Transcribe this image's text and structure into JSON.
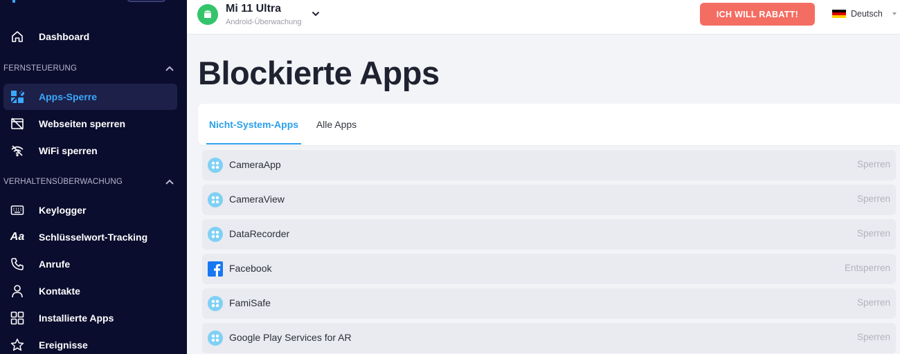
{
  "sidebar": {
    "items": [
      {
        "label": "Dashboard",
        "icon": "home-icon"
      },
      {
        "label": "Apps-Sperre",
        "icon": "app-block-icon",
        "active": true
      },
      {
        "label": "Webseiten sperren",
        "icon": "web-block-icon"
      },
      {
        "label": "WiFi sperren",
        "icon": "wifi-off-icon"
      },
      {
        "label": "Keylogger",
        "icon": "keyboard-icon"
      },
      {
        "label": "Schlüsselwort-Tracking",
        "icon": "text-aa-icon"
      },
      {
        "label": "Anrufe",
        "icon": "phone-icon"
      },
      {
        "label": "Kontakte",
        "icon": "person-icon"
      },
      {
        "label": "Installierte Apps",
        "icon": "grid-icon"
      },
      {
        "label": "Ereignisse",
        "icon": "star-icon"
      }
    ],
    "sections": [
      {
        "label": "FERNSTEUERUNG"
      },
      {
        "label": "VERHALTENSÜBERWACHUNG"
      }
    ],
    "active_color": "#3aa8ff",
    "background": "#0b0d2e"
  },
  "header": {
    "device_name": "Mi 11 Ultra",
    "device_subtitle": "Android-Überwachung",
    "rebate_button": "ICH WILL RABATT!",
    "language": "Deutsch",
    "rebate_color": "#f46d63"
  },
  "main": {
    "title": "Blockierte Apps",
    "tabs": [
      {
        "label": "Nicht-System-Apps",
        "active": true
      },
      {
        "label": "Alle Apps"
      }
    ],
    "apps": [
      {
        "name": "CameraApp",
        "action": "Sperren",
        "icon": "generic-app-icon"
      },
      {
        "name": "CameraView",
        "action": "Sperren",
        "icon": "generic-app-icon"
      },
      {
        "name": "DataRecorder",
        "action": "Sperren",
        "icon": "generic-app-icon"
      },
      {
        "name": "Facebook",
        "action": "Entsperren",
        "icon": "facebook-icon"
      },
      {
        "name": "FamiSafe",
        "action": "Sperren",
        "icon": "generic-app-icon"
      },
      {
        "name": "Google Play Services for AR",
        "action": "Sperren",
        "icon": "generic-app-icon"
      }
    ]
  }
}
